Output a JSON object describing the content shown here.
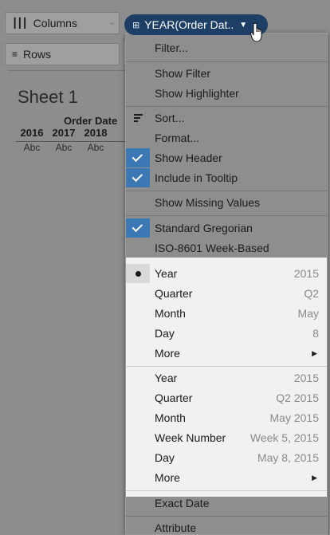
{
  "shelves": {
    "columns_label": "Columns",
    "rows_label": "Rows",
    "columns_icon": "columns-icon",
    "rows_icon": "rows-icon"
  },
  "pill": {
    "label": "YEAR(Order Dat..",
    "icon": "calendar-icon",
    "color": "#1d3f66"
  },
  "sheet": {
    "title": "Sheet 1",
    "column_header": "Order Date",
    "years": [
      "2016",
      "2017",
      "2018"
    ],
    "cells": [
      "Abc",
      "Abc",
      "Abc"
    ]
  },
  "menu": {
    "filter": "Filter...",
    "show_filter": "Show Filter",
    "show_highlighter": "Show Highlighter",
    "sort": "Sort...",
    "format": "Format...",
    "show_header": "Show Header",
    "include_tooltip": "Include in Tooltip",
    "show_missing": "Show Missing Values",
    "standard_gregorian": "Standard Gregorian",
    "iso_week": "ISO-8601 Week-Based",
    "discrete": [
      {
        "label": "Year",
        "value": "2015"
      },
      {
        "label": "Quarter",
        "value": "Q2"
      },
      {
        "label": "Month",
        "value": "May"
      },
      {
        "label": "Day",
        "value": "8"
      },
      {
        "label": "More",
        "value": ""
      }
    ],
    "continuous": [
      {
        "label": "Year",
        "value": "2015"
      },
      {
        "label": "Quarter",
        "value": "Q2 2015"
      },
      {
        "label": "Month",
        "value": "May 2015"
      },
      {
        "label": "Week Number",
        "value": "Week 5, 2015"
      },
      {
        "label": "Day",
        "value": "May 8, 2015"
      },
      {
        "label": "More",
        "value": ""
      }
    ],
    "exact_date": "Exact Date",
    "attribute": "Attribute",
    "checked_color": "#3c79b4"
  }
}
